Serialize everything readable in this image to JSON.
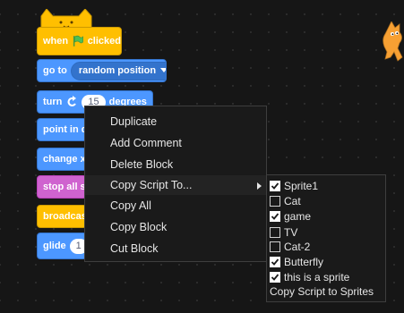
{
  "blocks": {
    "hat": {
      "when_label": "when",
      "clicked_label": "clicked"
    },
    "goto": {
      "label": "go to",
      "target": "random position"
    },
    "turn": {
      "label": "turn",
      "value": "15",
      "unit": "degrees"
    },
    "point": {
      "label": "point in di"
    },
    "change": {
      "label": "change x"
    },
    "stop": {
      "label": "stop all so"
    },
    "broadcast": {
      "label": "broadcas"
    },
    "glide": {
      "label": "glide",
      "value": "1"
    }
  },
  "context_menu": {
    "items": [
      {
        "label": "Duplicate"
      },
      {
        "label": "Add Comment"
      },
      {
        "label": "Delete Block"
      },
      {
        "label": "Copy Script To..."
      },
      {
        "label": "Copy All"
      },
      {
        "label": "Copy Block"
      },
      {
        "label": "Cut Block"
      }
    ]
  },
  "submenu": {
    "sprites": [
      {
        "label": "Sprite1",
        "checked": true
      },
      {
        "label": "Cat",
        "checked": false
      },
      {
        "label": "game",
        "checked": true
      },
      {
        "label": "TV",
        "checked": false
      },
      {
        "label": "Cat-2",
        "checked": false
      },
      {
        "label": "Butterfly",
        "checked": true
      },
      {
        "label": "this is a sprite",
        "checked": true
      }
    ],
    "action_label": "Copy Script to Sprites"
  },
  "colors": {
    "motion": "#4c97ff",
    "events": "#ffbf00",
    "control": "#ffab19",
    "sound": "#cf63cf",
    "background": "#161616"
  },
  "icons": {
    "green_flag": "green-flag-icon",
    "turn_left": "rotate-left-icon",
    "dropdown": "dropdown-arrow-icon",
    "submenu": "submenu-arrow-icon",
    "check": "checkmark-icon",
    "sprite": "scratch-cat-icon"
  }
}
